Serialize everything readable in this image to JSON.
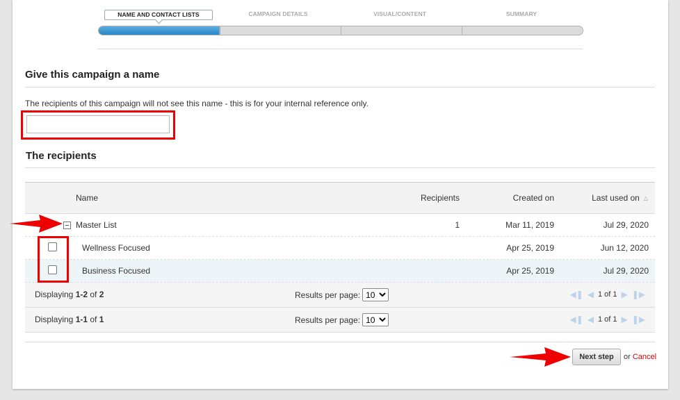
{
  "steps": [
    {
      "label": "NAME AND CONTACT LISTS",
      "active": true
    },
    {
      "label": "CAMPAIGN DETAILS",
      "active": false
    },
    {
      "label": "VISUAL/CONTENT",
      "active": false
    },
    {
      "label": "SUMMARY",
      "active": false
    }
  ],
  "campaign_name": {
    "heading": "Give this campaign a name",
    "help": "The recipients of this campaign will not see this name - this is for your internal reference only.",
    "value": "",
    "placeholder": ""
  },
  "recipients": {
    "heading": "The recipients",
    "columns": {
      "name": "Name",
      "recipients": "Recipients",
      "created": "Created on",
      "last_used": "Last used on"
    },
    "parent": {
      "name": "Master List",
      "recipients": "1",
      "created": "Mar 11, 2019",
      "last_used": "Jul 29, 2020"
    },
    "children": [
      {
        "name": "Wellness Focused",
        "created": "Apr 25, 2019",
        "last_used": "Jun 12, 2020"
      },
      {
        "name": "Business Focused",
        "created": "Apr 25, 2019",
        "last_used": "Jul 29, 2020"
      }
    ],
    "pagers": [
      {
        "displaying_prefix": "Displaying ",
        "range": "1-2",
        "of": " of ",
        "total": "2",
        "rpp_label": "Results per page:",
        "rpp_value": "10",
        "page": "1 of 1"
      },
      {
        "displaying_prefix": "Displaying ",
        "range": "1-1",
        "of": " of ",
        "total": "1",
        "rpp_label": "Results per page:",
        "rpp_value": "10",
        "page": "1 of 1"
      }
    ]
  },
  "actions": {
    "next_label": "Next step",
    "or_text": "or ",
    "cancel_label": "Cancel"
  },
  "colors": {
    "accent_blue": "#2a86c8",
    "annotation_red": "#e00000",
    "cancel_red": "#cc0000"
  }
}
